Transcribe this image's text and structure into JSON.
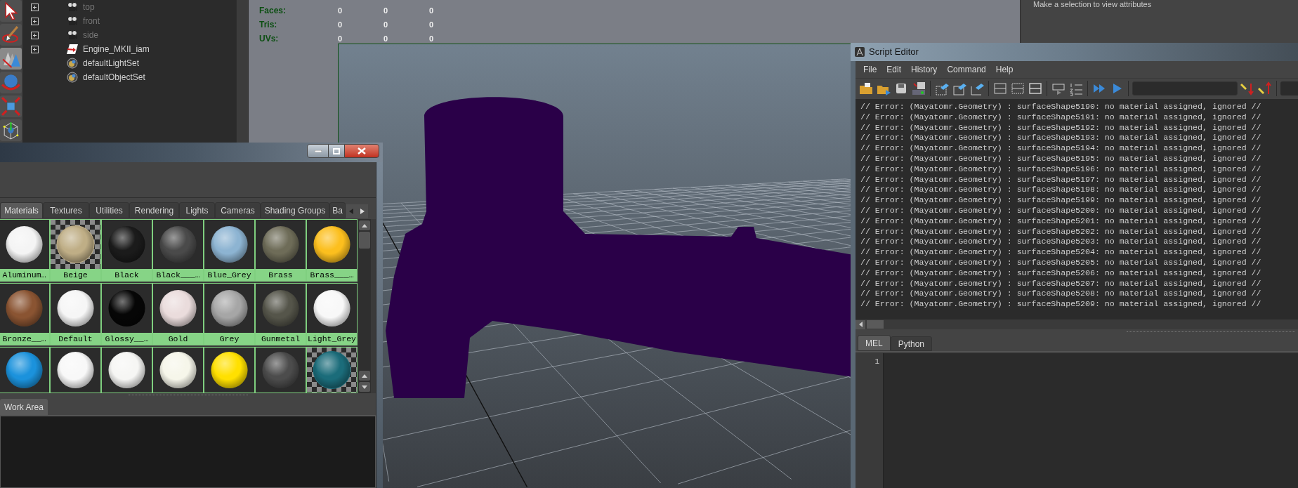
{
  "outliner": {
    "items": [
      {
        "label": "top",
        "kind": "camera",
        "expandable": true,
        "dimmed": true
      },
      {
        "label": "front",
        "kind": "camera",
        "expandable": true,
        "dimmed": true
      },
      {
        "label": "side",
        "kind": "camera",
        "expandable": true,
        "dimmed": true
      },
      {
        "label": "Engine_MKII_iam",
        "kind": "transform",
        "expandable": true,
        "dimmed": false
      },
      {
        "label": "defaultLightSet",
        "kind": "set",
        "expandable": false,
        "dimmed": false
      },
      {
        "label": "defaultObjectSet",
        "kind": "set",
        "expandable": false,
        "dimmed": false
      }
    ]
  },
  "viewport": {
    "hud": [
      {
        "label": "Faces:",
        "values": [
          "0",
          "0",
          "0"
        ]
      },
      {
        "label": "Tris:",
        "values": [
          "0",
          "0",
          "0"
        ]
      },
      {
        "label": "UVs:",
        "values": [
          "0",
          "0",
          "0"
        ]
      }
    ]
  },
  "attribute_editor": {
    "message": "Make a selection to view attributes"
  },
  "hypershade": {
    "tabs": [
      {
        "label": "Materials",
        "selected": true
      },
      {
        "label": "Textures",
        "selected": false
      },
      {
        "label": "Utilities",
        "selected": false
      },
      {
        "label": "Rendering",
        "selected": false
      },
      {
        "label": "Lights",
        "selected": false
      },
      {
        "label": "Cameras",
        "selected": false
      },
      {
        "label": "Shading Groups",
        "selected": false
      },
      {
        "label": "Ba",
        "selected": false
      }
    ],
    "swatches": [
      {
        "label": "Aluminum…",
        "kind": "sphere",
        "color": "#f4f4f4"
      },
      {
        "label": "Beige",
        "kind": "checker",
        "color": "#bfae86"
      },
      {
        "label": "Black",
        "kind": "sphere",
        "color": "#1b1b1b"
      },
      {
        "label": "Black___…",
        "kind": "sphere",
        "color": "#4a4a4a"
      },
      {
        "label": "Blue_Grey",
        "kind": "sphere",
        "color": "#8db4d2"
      },
      {
        "label": "Brass",
        "kind": "sphere",
        "color": "#6e6c58"
      },
      {
        "label": "Brass___…",
        "kind": "sphere",
        "color": "#fcbf1e"
      },
      {
        "label": "Bronze__…",
        "kind": "sphere",
        "color": "#8a5432"
      },
      {
        "label": "Default",
        "kind": "sphere",
        "color": "#f6f6f6"
      },
      {
        "label": "Glossy__…",
        "kind": "sphere",
        "color": "#060606"
      },
      {
        "label": "Gold",
        "kind": "sphere",
        "color": "#eadcdc"
      },
      {
        "label": "Grey",
        "kind": "sphere",
        "color": "#a6a6a6"
      },
      {
        "label": "Gunmetal",
        "kind": "sphere",
        "color": "#55554a"
      },
      {
        "label": "Light_Grey",
        "kind": "sphere",
        "color": "#f8f8f8"
      },
      {
        "kind": "sphere",
        "color": "#1b92dc"
      },
      {
        "kind": "sphere",
        "color": "#f8f8f8"
      },
      {
        "kind": "sphere",
        "color": "#f6f6f4"
      },
      {
        "kind": "sphere",
        "color": "#f6f6ea"
      },
      {
        "kind": "sphere",
        "color": "#ffe000"
      },
      {
        "kind": "sphere",
        "color": "#4c4c4c"
      },
      {
        "kind": "checker",
        "color": "#1b6c7a"
      }
    ],
    "work_area_tab": "Work Area"
  },
  "script_editor": {
    "title": "Script Editor",
    "menu": [
      "File",
      "Edit",
      "History",
      "Command",
      "Help"
    ],
    "output_lines": [
      "// Error: (Mayatomr.Geometry) : surfaceShape5190: no material assigned, ignored //",
      "// Error: (Mayatomr.Geometry) : surfaceShape5191: no material assigned, ignored //",
      "// Error: (Mayatomr.Geometry) : surfaceShape5192: no material assigned, ignored //",
      "// Error: (Mayatomr.Geometry) : surfaceShape5193: no material assigned, ignored //",
      "// Error: (Mayatomr.Geometry) : surfaceShape5194: no material assigned, ignored //",
      "// Error: (Mayatomr.Geometry) : surfaceShape5195: no material assigned, ignored //",
      "// Error: (Mayatomr.Geometry) : surfaceShape5196: no material assigned, ignored //",
      "// Error: (Mayatomr.Geometry) : surfaceShape5197: no material assigned, ignored //",
      "// Error: (Mayatomr.Geometry) : surfaceShape5198: no material assigned, ignored //",
      "// Error: (Mayatomr.Geometry) : surfaceShape5199: no material assigned, ignored //",
      "// Error: (Mayatomr.Geometry) : surfaceShape5200: no material assigned, ignored //",
      "// Error: (Mayatomr.Geometry) : surfaceShape5201: no material assigned, ignored //",
      "// Error: (Mayatomr.Geometry) : surfaceShape5202: no material assigned, ignored //",
      "// Error: (Mayatomr.Geometry) : surfaceShape5203: no material assigned, ignored //",
      "// Error: (Mayatomr.Geometry) : surfaceShape5204: no material assigned, ignored //",
      "// Error: (Mayatomr.Geometry) : surfaceShape5205: no material assigned, ignored //",
      "// Error: (Mayatomr.Geometry) : surfaceShape5206: no material assigned, ignored //",
      "// Error: (Mayatomr.Geometry) : surfaceShape5207: no material assigned, ignored //",
      "// Error: (Mayatomr.Geometry) : surfaceShape5208: no material assigned, ignored //",
      "// Error: (Mayatomr.Geometry) : surfaceShape5209: no material assigned, ignored //"
    ],
    "tabs": [
      {
        "label": "MEL",
        "selected": true
      },
      {
        "label": "Python",
        "selected": false
      }
    ],
    "line_numbers": [
      "1"
    ]
  }
}
